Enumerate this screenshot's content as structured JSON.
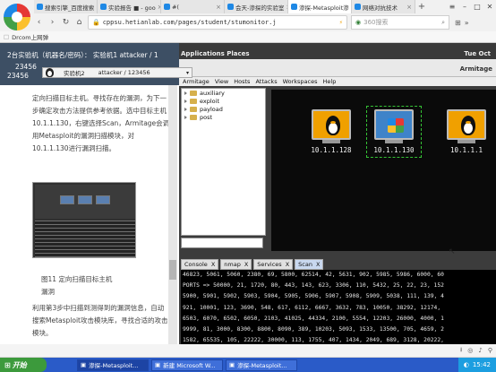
{
  "browser": {
    "tabs": [
      {
        "label": "搜索引擎_百度搜索",
        "active": false
      },
      {
        "label": "实验报告 ■ - goo",
        "active": false
      },
      {
        "label": "#(",
        "active": false
      },
      {
        "label": "会天-渗探的实验室",
        "active": false
      },
      {
        "label": "渗探-Metasploit渗",
        "active": true
      },
      {
        "label": "网络对抗技术",
        "active": false
      }
    ],
    "address": "cppsu.hetianlab.com/pages/student/stumonitor.j",
    "search_placeholder": "360搜索",
    "bookmark": "Drcom上网弹"
  },
  "guide": {
    "header_line1": "2台实验机（机器名/密码）： 实验机1  attacker / 1",
    "header_line2": "23456",
    "header_line3": "23456",
    "paragraph1": "定向扫描目标主机。寻找存在的漏洞，为下一步确定攻击方法提供参考依据。选中目标主机10.1.1.130，右键选择Scan，Armitage会调用Metasploit的漏洞扫描模块，对10.1.1.130进行漏洞扫描。",
    "caption": "图11 定向扫描目标主机",
    "caption2": "漏洞",
    "paragraph2": "利用第3步中扫描到测得到的漏洞信息，自动搜索Metasploit攻击模块库，寻找合适的攻击模块。"
  },
  "vm_bar": {
    "name": "实验机2",
    "user": "attacker / 123456"
  },
  "gnome": {
    "apps": "Applications  Places",
    "time": "Tue Oct"
  },
  "armitage": {
    "title": "Armitage",
    "menu": [
      "Armitage",
      "View",
      "Hosts",
      "Attacks",
      "Workspaces",
      "Help"
    ],
    "modules": [
      "auxiliary",
      "exploit",
      "payload",
      "post"
    ],
    "hosts": [
      {
        "ip": "10.1.1.128",
        "os": "linux",
        "selected": false
      },
      {
        "ip": "10.1.1.130",
        "os": "windows",
        "selected": true
      },
      {
        "ip": "10.1.1.1",
        "os": "linux",
        "selected": false
      }
    ],
    "console_tabs": [
      {
        "label": "Console",
        "active": false
      },
      {
        "label": "nmap",
        "active": false
      },
      {
        "label": "Services",
        "active": false
      },
      {
        "label": "Scan",
        "active": true
      }
    ],
    "console_lines": [
      "46823, 5061, 5060, 2380, 69, 5800, 62514, 42, 5631, 902, 5985, 5986, 6000, 60",
      "PORTS => 50000, 21, 1720, 80, 443, 143, 623, 3306, 110, 5432, 25, 22, 23, 152",
      "5900, 5901, 5902, 5903, 5904, 5905, 5906, 5907, 5908, 5909, 5038, 111, 139, 4",
      "921, 10001, 123, 3690, 548, 617, 6112, 6667, 3632, 783, 10050, 38292, 12174,",
      "6503, 6070, 6502, 6050, 2103, 41025, 44334, 2100, 5554, 12203, 26000, 4000, 1",
      "9999, 81, 3000, 8300, 8800, 8090, 389, 10203, 5093, 1533, 13500, 705, 4659, 2",
      "1582, 65535, 105, 22222, 30000, 113, 1755, 407, 1434, 2049, 689, 3128, 20222,"
    ]
  },
  "taskbar": {
    "start": "开始",
    "tasks": [
      {
        "label": "渗探-Metasploit...",
        "active": true
      },
      {
        "label": "新建 Microsoft W...",
        "active": false
      },
      {
        "label": "渗探-Metasploit...",
        "active": false
      }
    ],
    "clock": "15:42"
  }
}
